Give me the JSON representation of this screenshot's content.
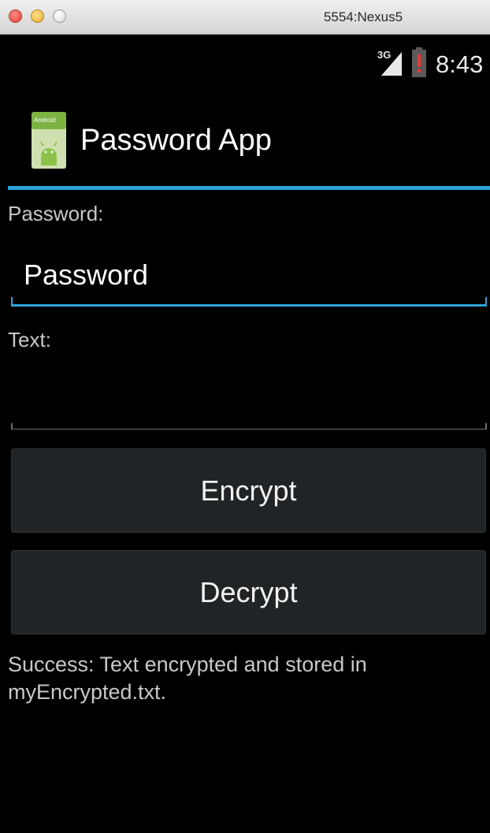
{
  "window": {
    "title": "5554:Nexus5"
  },
  "statusbar": {
    "network_label": "3G",
    "time": "8:43",
    "network_icon": "signal-3g-icon",
    "battery_icon": "battery-alert-icon"
  },
  "actionbar": {
    "title": "Password App",
    "icon": "android-app-icon",
    "icon_text": "Android",
    "accent_color": "#2ea3d8"
  },
  "form": {
    "password_label": "Password:",
    "password_value": "Password",
    "text_label": "Text:",
    "text_value": ""
  },
  "buttons": {
    "encrypt_label": "Encrypt",
    "decrypt_label": "Decrypt"
  },
  "status_message": "Success: Text encrypted and stored in myEncrypted.txt."
}
